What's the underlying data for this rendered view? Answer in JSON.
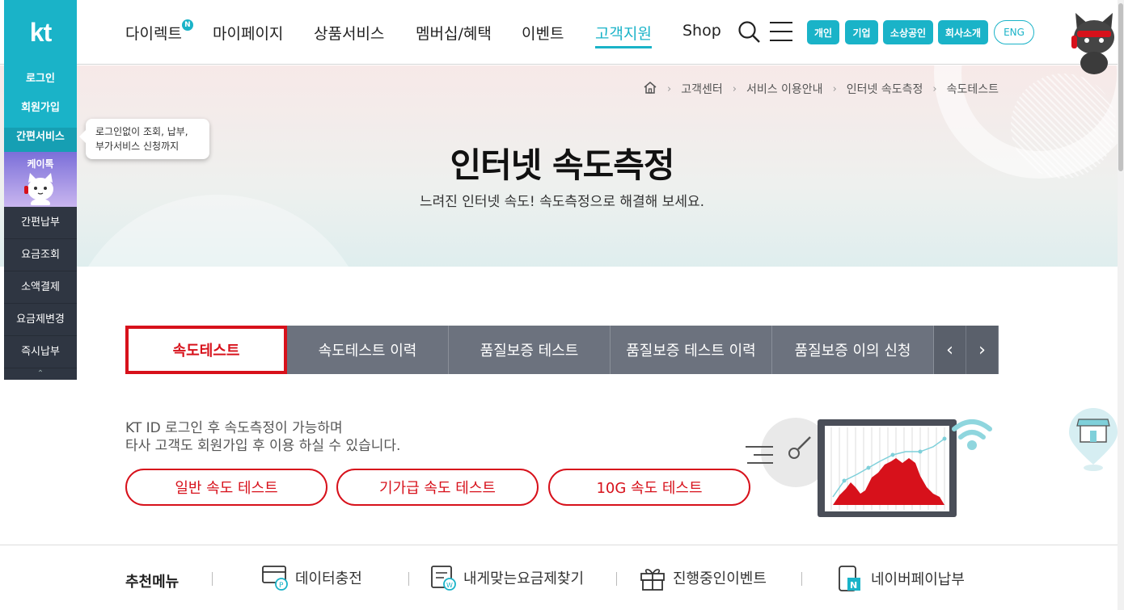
{
  "header": {
    "logo": "kt",
    "nav": [
      "다이렉트",
      "마이페이지",
      "상품서비스",
      "멤버십/혜택",
      "이벤트",
      "고객지원",
      "Shop"
    ],
    "new_badge": "N",
    "active_nav": "고객지원",
    "segments": [
      "개인",
      "기업",
      "소상공인",
      "회사소개",
      "ENG"
    ]
  },
  "quick": {
    "top_items": [
      "로그인",
      "회원가입",
      "간편서비스"
    ],
    "ktalk_label": "케이톡",
    "bottom_items": [
      "간편납부",
      "요금조회",
      "소액결제",
      "요금제변경",
      "즉시납부"
    ],
    "tooltip_line1": "로그인없이 조회, 납부,",
    "tooltip_line2": "부가서비스 신청까지"
  },
  "breadcrumb": [
    "고객센터",
    "서비스 이용안내",
    "인터넷 속도측정",
    "속도테스트"
  ],
  "hero": {
    "title": "인터넷 속도측정",
    "subtitle": "느려진 인터넷 속도! 속도측정으로 해결해 보세요."
  },
  "tabs": [
    "속도테스트",
    "속도테스트 이력",
    "품질보증 테스트",
    "품질보증 테스트 이력",
    "품질보증 이의 신청"
  ],
  "info": {
    "line1": "KT ID 로그인 후 속도측정이 가능하며",
    "line2": "타사 고객도 회원가입 후 이용 하실 수 있습니다."
  },
  "speed_buttons": [
    "일반 속도 테스트",
    "기가급 속도 테스트",
    "10G 속도 테스트"
  ],
  "recommend": {
    "title": "추천메뉴",
    "items": [
      "데이터충전",
      "내게맞는요금제찾기",
      "진행중인이벤트",
      "네이버페이납부"
    ]
  },
  "colors": {
    "accent": "#1ab3c8",
    "red": "#d7111b",
    "tab_bg": "#6c727e",
    "quick_dark": "#2f3642"
  }
}
